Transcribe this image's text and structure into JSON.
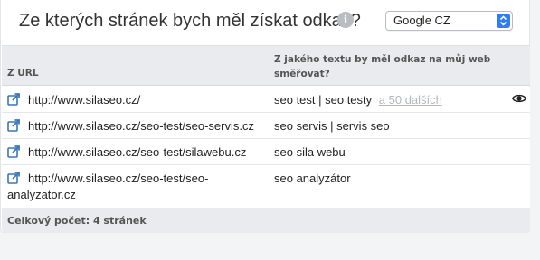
{
  "header": {
    "title": "Ze kterých stránek bych měl získat odkaz?",
    "info_glyph": "i",
    "search_engine_select": {
      "selected": "Google CZ"
    }
  },
  "table": {
    "columns": {
      "url": "Z URL",
      "anchor_text": "Z jakého textu by měl odkaz na můj web směřovat?"
    },
    "rows": [
      {
        "url": "http://www.silaseo.cz/",
        "anchor_text": "seo test | seo testy",
        "more_link": "a 50 dalších"
      },
      {
        "url": "http://www.silaseo.cz/seo-test/seo-servis.cz",
        "anchor_text": "seo servis | servis seo"
      },
      {
        "url": "http://www.silaseo.cz/seo-test/silawebu.cz",
        "anchor_text": "seo sila webu"
      },
      {
        "url": "http://www.silaseo.cz/seo-test/seo-analyzator.cz",
        "anchor_text": "seo analyzátor"
      }
    ],
    "footer": "Celkový počet: 4 stránek"
  },
  "colors": {
    "accent": "#2f7cf6",
    "link_icon": "#3a76b8",
    "muted_link": "#b3b6bb",
    "header_bg": "#e9ebee"
  },
  "icons": {
    "row_link": "external-link-icon",
    "preview": "eye-icon",
    "info": "info-icon",
    "select": "chevron-up-down-icon"
  }
}
